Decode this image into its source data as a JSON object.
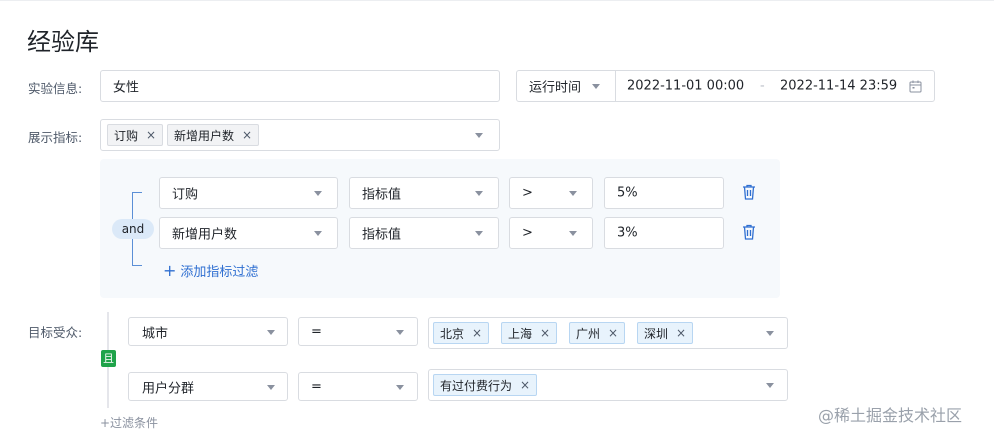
{
  "page": {
    "title": "经验库"
  },
  "experiment_info": {
    "label": "实验信息:",
    "keyword": "女性",
    "time_type": "运行时间",
    "start": "2022-11-01 00:00",
    "separator": "-",
    "end": "2022-11-14 23:59"
  },
  "metrics": {
    "label": "展示指标:",
    "tags": [
      "订购",
      "新增用户数"
    ],
    "tag_close": "×"
  },
  "filters": {
    "logic": "and",
    "rows": [
      {
        "metric": "订购",
        "field": "指标值",
        "operator": ">",
        "value": "5%"
      },
      {
        "metric": "新增用户数",
        "field": "指标值",
        "operator": ">",
        "value": "3%"
      }
    ],
    "add_label": "添加指标过滤",
    "add_icon": "+"
  },
  "audience": {
    "label": "目标受众:",
    "logic": "且",
    "rows": [
      {
        "dimension": "城市",
        "operator": "=",
        "values": [
          "北京",
          "上海",
          "广州",
          "深圳"
        ]
      },
      {
        "dimension": "用户分群",
        "operator": "=",
        "values": [
          "有过付费行为"
        ]
      }
    ],
    "add_label": "+过滤条件",
    "tag_close": "×"
  },
  "watermark": "@稀土掘金技术社区",
  "colors": {
    "accent": "#2f6fd1",
    "tag_bg": "#e8f3fc",
    "green": "#1fa34a",
    "panel_bg": "#f6f9fc"
  }
}
